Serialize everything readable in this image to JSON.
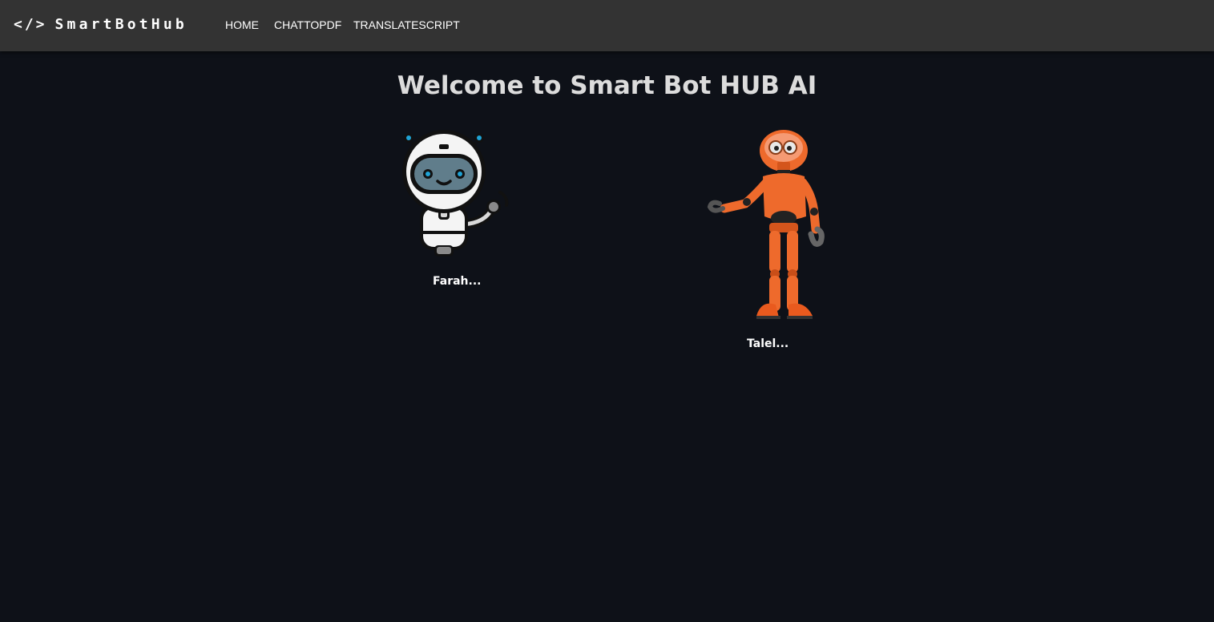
{
  "navbar": {
    "logo_code": "</>",
    "logo_text": "SmartBotHub",
    "links": [
      "HOME",
      "CHATTOPDF",
      "TRANSLATESCRIPT"
    ]
  },
  "main": {
    "title": "Welcome to Smart Bot HUB AI",
    "bots": [
      {
        "name": "Farah...",
        "avatar_icon": "white-robot-waving-icon"
      },
      {
        "name": "Talel...",
        "avatar_icon": "orange-humanoid-robot-icon"
      }
    ]
  },
  "colors": {
    "navbar_bg": "#333333",
    "page_bg": "#0e1118",
    "title_text": "#dcdcdc",
    "robot_orange": "#ee6a2c",
    "robot_blue_accent": "#1fa3d6"
  }
}
